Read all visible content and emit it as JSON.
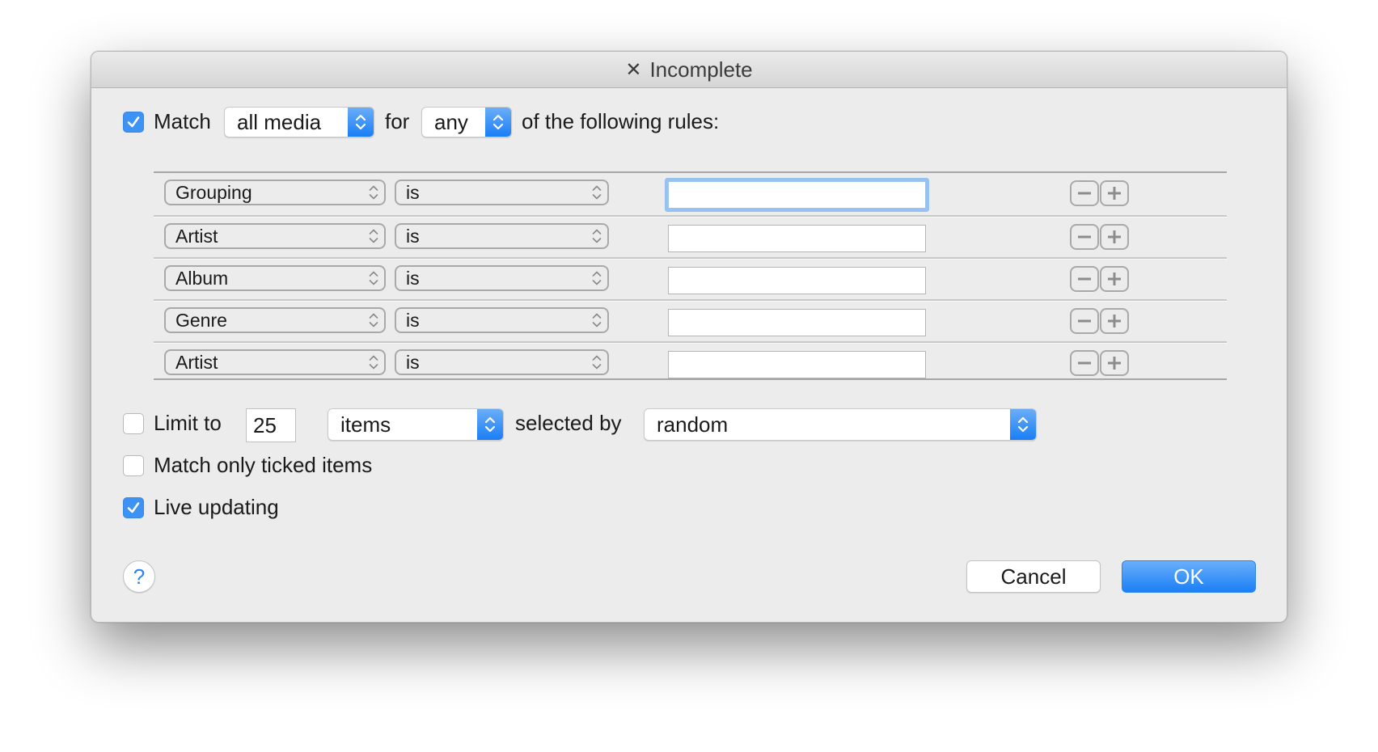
{
  "window": {
    "title": "Incomplete",
    "title_prefix_icon": "close-x-icon"
  },
  "match_row": {
    "checked": true,
    "label": "Match",
    "media_select": "all media",
    "for_label": "for",
    "any_select": "any",
    "suffix": "of the following rules:"
  },
  "rules": [
    {
      "field": "Grouping",
      "operator": "is",
      "value": "",
      "focused": true
    },
    {
      "field": "Artist",
      "operator": "is",
      "value": "",
      "focused": false
    },
    {
      "field": "Album",
      "operator": "is",
      "value": "",
      "focused": false
    },
    {
      "field": "Genre",
      "operator": "is",
      "value": "",
      "focused": false
    },
    {
      "field": "Artist",
      "operator": "is",
      "value": "",
      "focused": false
    }
  ],
  "rule_buttons": {
    "remove": "−",
    "add": "+"
  },
  "limit": {
    "checked": false,
    "label": "Limit to",
    "value": "25",
    "unit_select": "items",
    "selected_by_label": "selected by",
    "selected_by_select": "random"
  },
  "match_ticked": {
    "checked": false,
    "label": "Match only ticked items"
  },
  "live_updating": {
    "checked": true,
    "label": "Live updating"
  },
  "footer": {
    "help": "?",
    "cancel": "Cancel",
    "ok": "OK"
  },
  "colors": {
    "accent": "#1b7ff6",
    "focus_ring": "#95c2f1",
    "window_bg": "#ececec"
  }
}
